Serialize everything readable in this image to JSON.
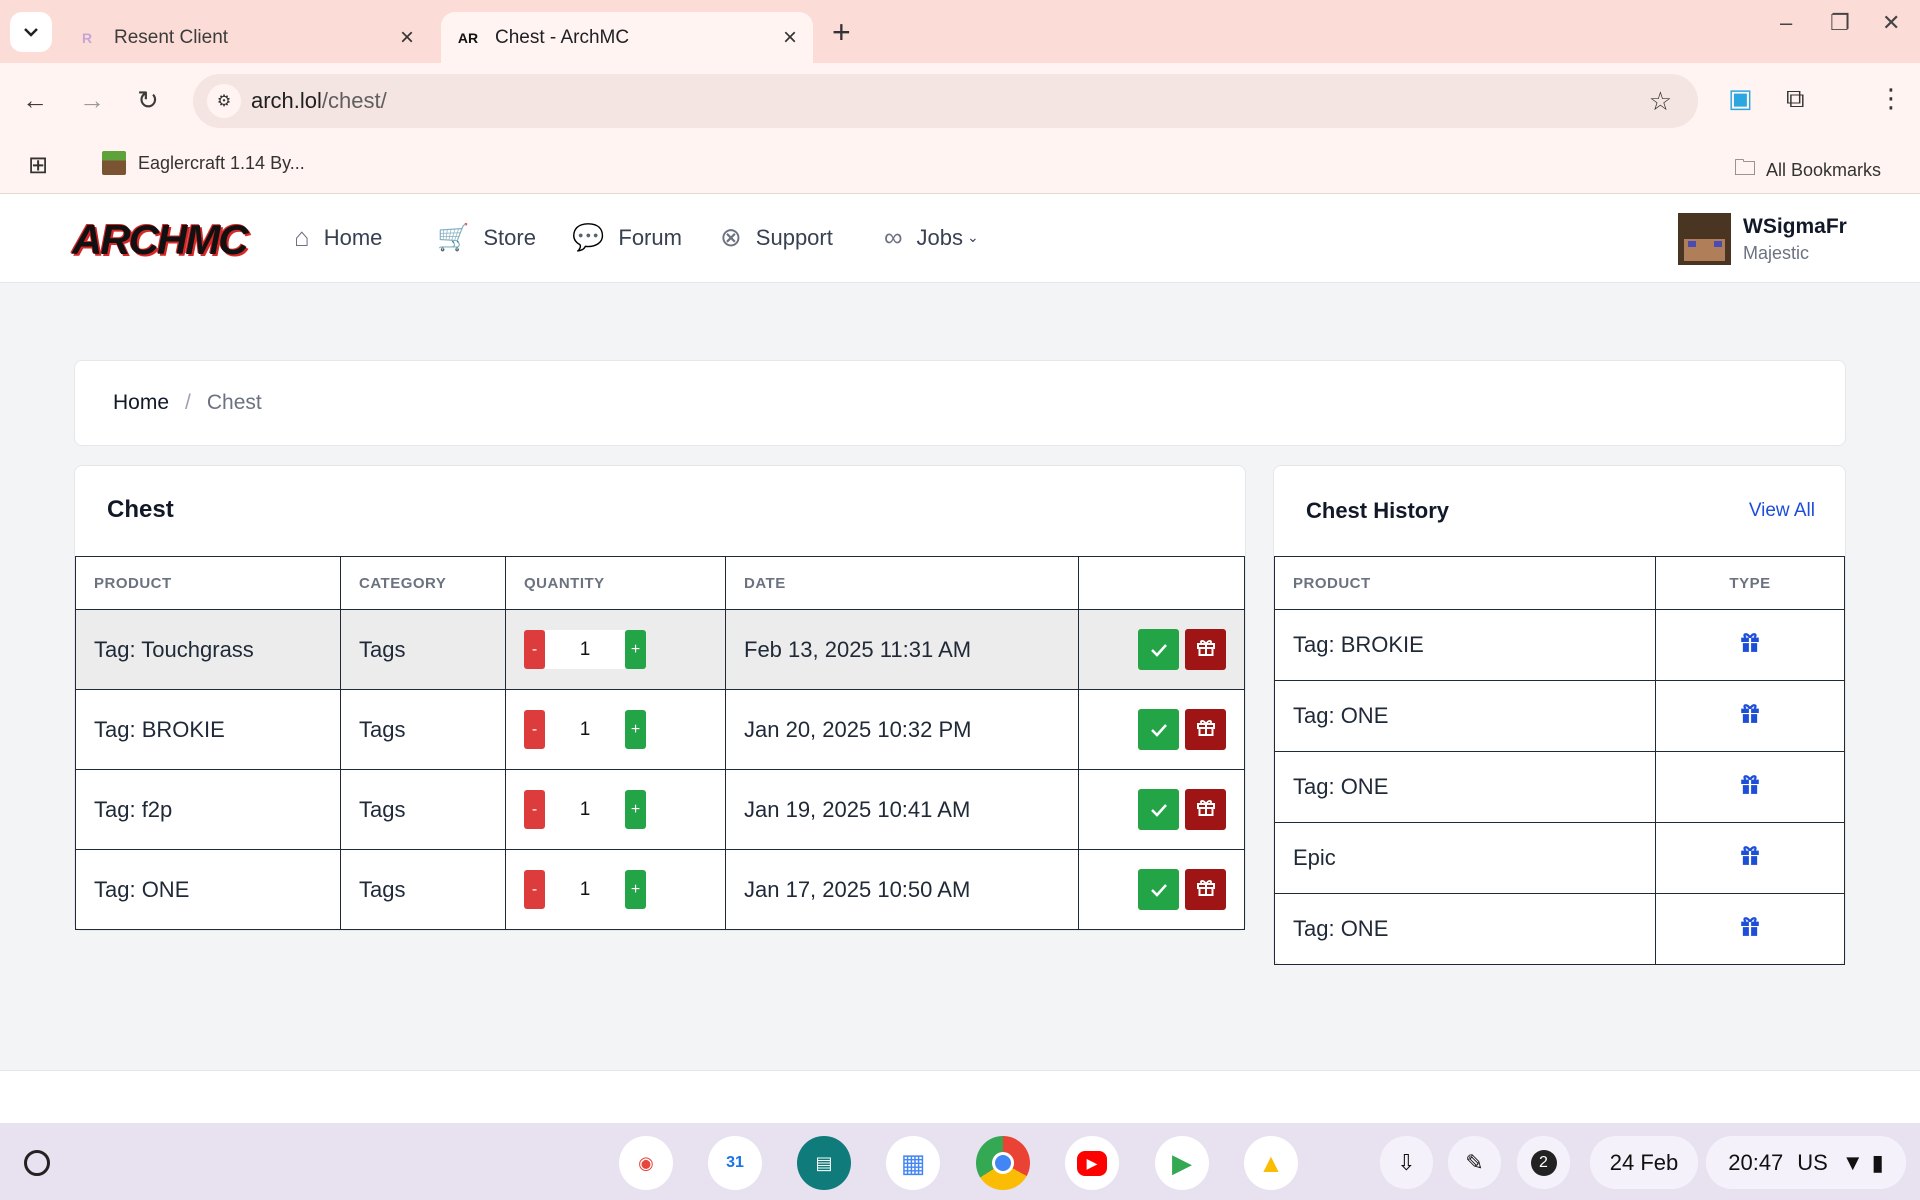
{
  "browser": {
    "tabs": [
      {
        "title": "Resent Client",
        "active": false
      },
      {
        "title": "Chest - ArchMC",
        "active": true
      }
    ],
    "url_host": "arch.lol",
    "url_path": "/chest/",
    "bookmarks": [
      {
        "label": "Eaglercraft 1.14 By..."
      }
    ],
    "all_bookmarks_label": "All Bookmarks"
  },
  "site": {
    "logo_text": "ARCHMC",
    "nav": [
      {
        "label": "Home",
        "icon": "home-icon"
      },
      {
        "label": "Store",
        "icon": "cart-icon"
      },
      {
        "label": "Forum",
        "icon": "chat-icon"
      },
      {
        "label": "Support",
        "icon": "lifebuoy-icon"
      },
      {
        "label": "Jobs",
        "icon": "link-icon"
      }
    ],
    "user": {
      "name": "WSigmaFr",
      "rank": "Majestic"
    }
  },
  "breadcrumb": {
    "home": "Home",
    "separator": "/",
    "current": "Chest"
  },
  "chest": {
    "title": "Chest",
    "columns": [
      "PRODUCT",
      "CATEGORY",
      "QUANTITY",
      "DATE",
      ""
    ],
    "rows": [
      {
        "product": "Tag: Touchgrass",
        "category": "Tags",
        "quantity": "1",
        "date": "Feb 13, 2025 11:31 AM"
      },
      {
        "product": "Tag: BROKIE",
        "category": "Tags",
        "quantity": "1",
        "date": "Jan 20, 2025 10:32 PM"
      },
      {
        "product": "Tag: f2p",
        "category": "Tags",
        "quantity": "1",
        "date": "Jan 19, 2025 10:41 AM"
      },
      {
        "product": "Tag: ONE",
        "category": "Tags",
        "quantity": "1",
        "date": "Jan 17, 2025 10:50 AM"
      }
    ],
    "minus_label": "-",
    "plus_label": "+"
  },
  "history": {
    "title": "Chest History",
    "view_all": "View All",
    "columns": [
      "PRODUCT",
      "TYPE"
    ],
    "rows": [
      {
        "product": "Tag: BROKIE",
        "type_icon": "gift-icon"
      },
      {
        "product": "Tag: ONE",
        "type_icon": "gift-icon"
      },
      {
        "product": "Tag: ONE",
        "type_icon": "gift-icon"
      },
      {
        "product": "Epic",
        "type_icon": "gift-icon"
      },
      {
        "product": "Tag: ONE",
        "type_icon": "gift-icon"
      }
    ]
  },
  "shelf": {
    "notification_count": "2",
    "date": "24 Feb",
    "time": "20:47",
    "locale": "US"
  },
  "colors": {
    "accept": "#22a447",
    "gift": "#9f1414",
    "minus": "#dc3c3c",
    "link": "#1d4ed8"
  }
}
